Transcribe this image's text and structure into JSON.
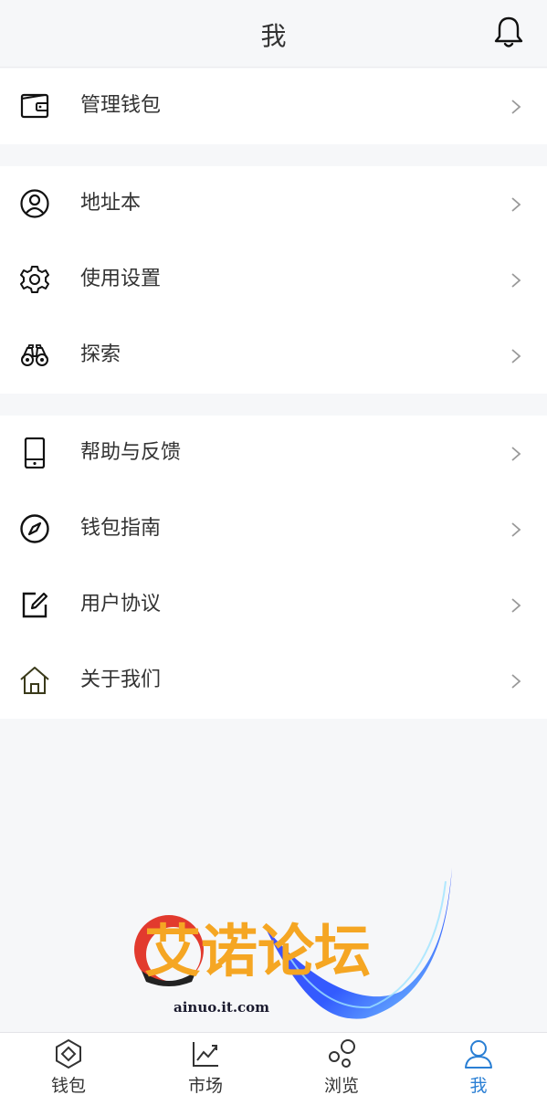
{
  "header": {
    "title": "我",
    "notification_icon": "bell-icon"
  },
  "menu_groups": [
    {
      "items": [
        {
          "label": "管理钱包",
          "icon": "wallet-icon"
        }
      ]
    },
    {
      "items": [
        {
          "label": "地址本",
          "icon": "user-circle-icon"
        },
        {
          "label": "使用设置",
          "icon": "gear-icon"
        },
        {
          "label": "探索",
          "icon": "binoculars-icon"
        }
      ]
    },
    {
      "items": [
        {
          "label": "帮助与反馈",
          "icon": "phone-icon"
        },
        {
          "label": "钱包指南",
          "icon": "compass-icon"
        },
        {
          "label": "用户协议",
          "icon": "edit-icon"
        },
        {
          "label": "关于我们",
          "icon": "home-icon"
        }
      ]
    }
  ],
  "watermark": {
    "title": "艾诺论坛",
    "url": "ainuo.it.com"
  },
  "tabbar": {
    "active_index": 3,
    "active_color": "#2a7fd4",
    "tabs": [
      {
        "label": "钱包",
        "icon": "hexagon-coin-icon"
      },
      {
        "label": "市场",
        "icon": "chart-icon"
      },
      {
        "label": "浏览",
        "icon": "bubbles-icon"
      },
      {
        "label": "我",
        "icon": "person-icon"
      }
    ]
  }
}
